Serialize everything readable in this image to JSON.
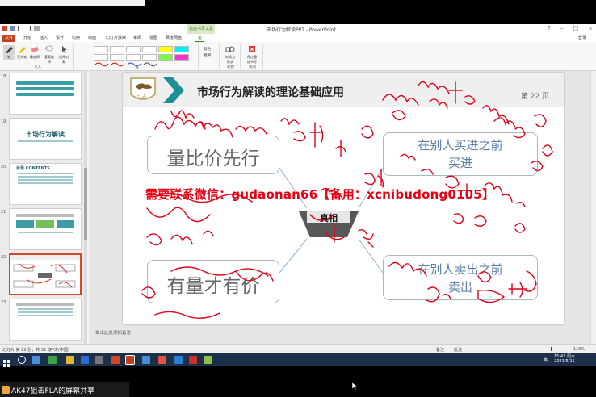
{
  "app": {
    "window_title": "市场行为解读PPT - PowerPoint",
    "context_tab": "墨迹书写工具",
    "user": "登录"
  },
  "tabs": [
    {
      "label": "文件"
    },
    {
      "label": "开始"
    },
    {
      "label": "插入"
    },
    {
      "label": "设计"
    },
    {
      "label": "切换"
    },
    {
      "label": "动画"
    },
    {
      "label": "幻灯片放映"
    },
    {
      "label": "审阅"
    },
    {
      "label": "视图"
    },
    {
      "label": "百度网盘"
    },
    {
      "label": "笔"
    }
  ],
  "ribbon": {
    "tools": [
      {
        "label": "笔",
        "icon": "pen-icon"
      },
      {
        "label": "荧光笔",
        "icon": "highlighter-icon"
      },
      {
        "label": "橡皮擦",
        "icon": "eraser-icon"
      },
      {
        "label": "套索选择",
        "icon": "lasso-icon"
      },
      {
        "label": "选择对象",
        "icon": "select-object-icon"
      }
    ],
    "group_write": "写入",
    "group_pens": "笔",
    "color_label": "颜色",
    "thickness_label": "粗细",
    "convert_label": "转换为形状",
    "stop_label": "停止墨迹书写",
    "group_convert": "转换",
    "group_close": "关闭",
    "tooltip": "笔"
  },
  "thumbnails": [
    {
      "num": "18",
      "title": ""
    },
    {
      "num": "19",
      "title": "市场行为解读"
    },
    {
      "num": "20",
      "title": "目录 CONTENTS"
    },
    {
      "num": "21",
      "title": ""
    },
    {
      "num": "22",
      "title": ""
    },
    {
      "num": "23",
      "title": ""
    }
  ],
  "slide": {
    "title": "市场行为解读的理论基础应用",
    "page": "第 22 页",
    "logo_text": "FLA",
    "box_tl": "量比价先行",
    "box_bl": "有量才有价",
    "box_tr_line1": "在别人买进之前",
    "box_tr_line2": "买进",
    "box_br_line1": "在别人卖出之前",
    "box_br_line2": "卖出",
    "center": "真相",
    "watermark": "需要联系微信：gudaonan66【备用：xcnibudong0105】"
  },
  "notes_placeholder": "单击此处添加备注",
  "status": {
    "slide_info": "幻灯片 第 22 张，共 31 张",
    "language": "中文(中国)",
    "notes": "备注",
    "comments": "批注",
    "zoom": "110%"
  },
  "taskbar": {
    "lang": "英",
    "time": "15:41 周六",
    "date": "2021/5/15"
  },
  "share": {
    "label": "AK47狙击FLA的屏幕共享"
  },
  "colors": {
    "accent": "#c43e1c",
    "teal": "#1f8f97",
    "ink": "#e0001a",
    "watermark": "#e60012"
  }
}
